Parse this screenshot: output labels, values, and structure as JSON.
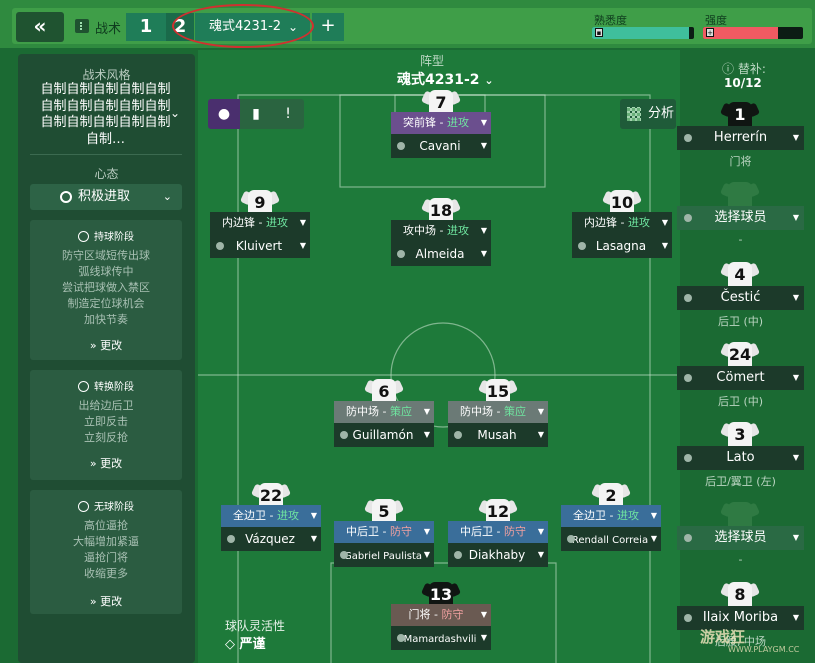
{
  "topbar": {
    "back_icon": "double-chevron-left",
    "tactics_label": "战术",
    "slot1": "1",
    "slot2": "2",
    "formation_tab": "魂式4231-2",
    "add_label": "+",
    "familiarity_label": "熟悉度",
    "familiarity_value": 0.95,
    "intensity_label": "强度",
    "intensity_value": 0.75
  },
  "left": {
    "style_title": "战术风格",
    "style_text": "自制自制自制自制自制自制自制自制自制自制自制自制自制自制自制自制…",
    "mentality_title": "心态",
    "mentality_value": "积极进取",
    "phases": [
      {
        "title": "持球阶段",
        "items": [
          "防守区域短传出球",
          "弧线球传中",
          "尝试把球做入禁区",
          "制造定位球机会",
          "加快节奏"
        ],
        "change": "更改"
      },
      {
        "title": "转换阶段",
        "items": [
          "出给边后卫",
          "立即反击",
          "立刻反抢"
        ],
        "change": "更改"
      },
      {
        "title": "无球阶段",
        "items": [
          "高位逼抢",
          "大幅增加紧逼",
          "逼抢门将",
          "收缩更多"
        ],
        "change": "更改"
      }
    ],
    "flex_label": "球队灵活性",
    "flex_value": "严谨"
  },
  "pitch": {
    "formation_title": "阵型",
    "formation_name": "魂式4231-2",
    "analysis_label": "分析",
    "players": [
      {
        "num": "7",
        "role": "突前锋",
        "duty": "进攻",
        "name": "Cavani",
        "role_color": "#6b4f8e"
      },
      {
        "num": "9",
        "role": "内边锋",
        "duty": "进攻",
        "name": "Kluivert",
        "role_color": "#1c3a2a"
      },
      {
        "num": "18",
        "role": "攻中场",
        "duty": "进攻",
        "name": "Almeida",
        "role_color": "#1c3a2a"
      },
      {
        "num": "10",
        "role": "内边锋",
        "duty": "进攻",
        "name": "Lasagna",
        "role_color": "#1c3a2a"
      },
      {
        "num": "6",
        "role": "防中场",
        "duty": "策应",
        "name": "Guillamón",
        "role_color": "#6b7a76"
      },
      {
        "num": "15",
        "role": "防中场",
        "duty": "策应",
        "name": "Musah",
        "role_color": "#6b7a76"
      },
      {
        "num": "22",
        "role": "全边卫",
        "duty": "进攻",
        "name": "Vázquez",
        "role_color": "#3a6e9a"
      },
      {
        "num": "5",
        "role": "中后卫",
        "duty": "防守",
        "name": "Gabriel Paulista",
        "role_color": "#3a6e9a"
      },
      {
        "num": "12",
        "role": "中后卫",
        "duty": "防守",
        "name": "Diakhaby",
        "role_color": "#3a6e9a"
      },
      {
        "num": "2",
        "role": "全边卫",
        "duty": "进攻",
        "name": "Rendall Correia",
        "role_color": "#3a6e9a"
      },
      {
        "num": "13",
        "role": "门将",
        "duty": "防守",
        "name": "Mamardashvili",
        "role_color": "#6a5a52"
      }
    ]
  },
  "subs": {
    "title": "替补:",
    "count": "10/12",
    "items": [
      {
        "num": "1",
        "name": "Herrerín",
        "pos": "门将",
        "gk": true
      },
      {
        "num": "",
        "name": "选择球员",
        "pos": "-",
        "empty": true
      },
      {
        "num": "4",
        "name": "Čestić",
        "pos": "后卫 (中)"
      },
      {
        "num": "24",
        "name": "Cömert",
        "pos": "后卫 (中)"
      },
      {
        "num": "3",
        "name": "Lato",
        "pos": "后卫/翼卫 (左)"
      },
      {
        "num": "",
        "name": "选择球员",
        "pos": "-",
        "empty": true
      },
      {
        "num": "8",
        "name": "Ilaix Moriba",
        "pos": "后腰, 中场"
      }
    ]
  },
  "watermark": "游戏狂",
  "watermark2": "WWW.PLAYGM.CC"
}
